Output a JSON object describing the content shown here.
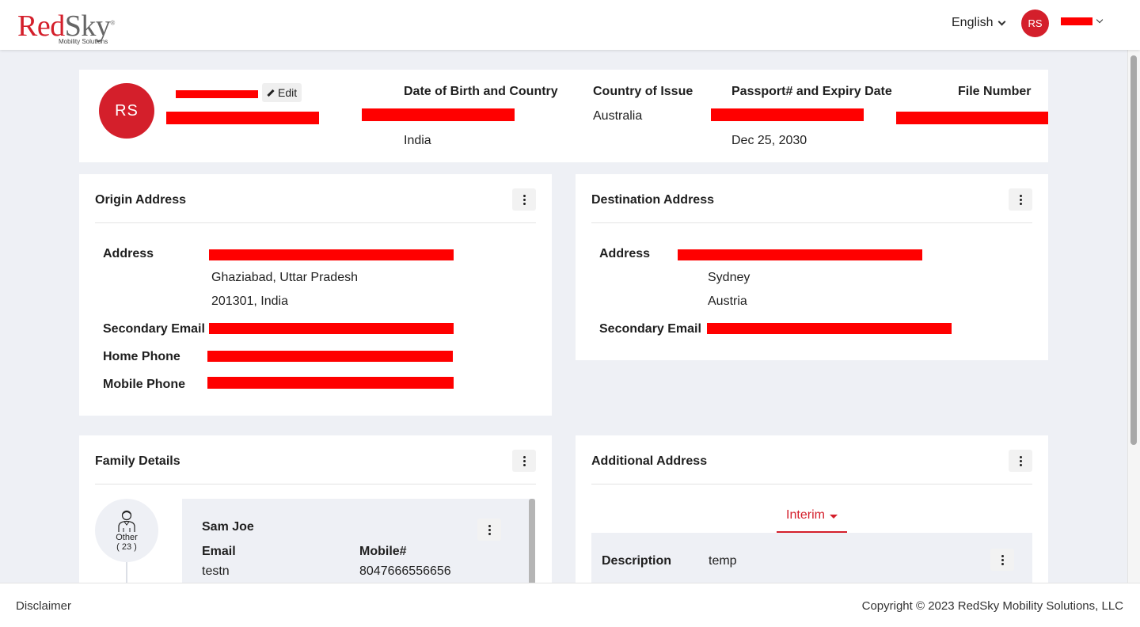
{
  "header": {
    "logo_text_a": "Red",
    "logo_text_b": "Sky",
    "logo_tagline": "Mobility Solutions",
    "language": "English",
    "avatar_initials": "RS"
  },
  "profile": {
    "avatar_initials": "RS",
    "edit_label": "Edit",
    "dob_label": "Date of Birth and Country",
    "dob_country": "India",
    "country_issue_label": "Country of Issue",
    "country_issue_value": "Australia",
    "passport_label": "Passport# and Expiry Date",
    "passport_expiry": "Dec 25, 2030",
    "file_number_label": "File Number"
  },
  "origin": {
    "title": "Origin Address",
    "address_label": "Address",
    "address_line2": "Ghaziabad, Uttar Pradesh",
    "address_line3": "201301, India",
    "secondary_email_label": "Secondary Email",
    "home_phone_label": "Home Phone",
    "mobile_phone_label": "Mobile Phone"
  },
  "destination": {
    "title": "Destination Address",
    "address_label": "Address",
    "address_line2": "Sydney",
    "address_line3": "Austria",
    "secondary_email_label": "Secondary Email"
  },
  "family": {
    "title": "Family Details",
    "member_relation": "Other",
    "member_age": "( 23 )",
    "member_name": "Sam Joe",
    "email_label": "Email",
    "email_value": "testn",
    "mobile_label": "Mobile#",
    "mobile_value": "8047666556656"
  },
  "additional": {
    "title": "Additional Address",
    "tab_label": "Interim",
    "description_label": "Description",
    "description_value": "temp"
  },
  "footer": {
    "disclaimer": "Disclaimer",
    "copyright": "Copyright © 2023 RedSky Mobility Solutions, LLC"
  },
  "colors": {
    "brand_red": "#d41f2b",
    "redaction": "#ff0000",
    "page_bg": "#eef0f5"
  }
}
